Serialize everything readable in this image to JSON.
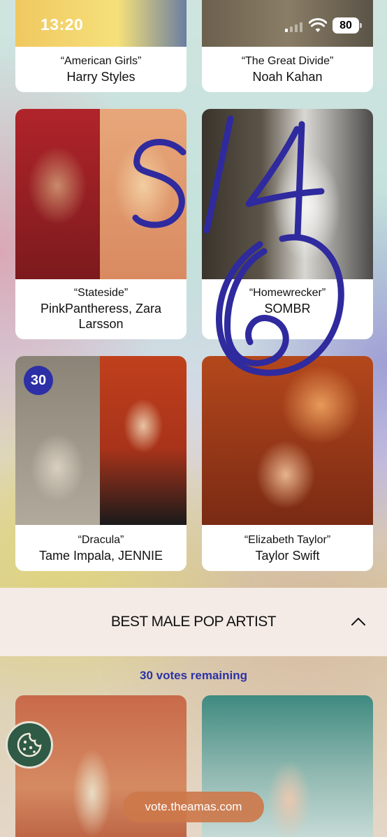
{
  "status_bar": {
    "time": "13:20",
    "battery": "80"
  },
  "nominees_top": [
    {
      "song": "“American Girls”",
      "artist": "Harry Styles"
    },
    {
      "song": "“The Great Divide”",
      "artist": "Noah Kahan"
    }
  ],
  "nominees": [
    {
      "song": "“Stateside”",
      "artist": "PinkPantheress, Zara Larsson"
    },
    {
      "song": "“Homewrecker”",
      "artist": "SOMBR"
    },
    {
      "song": "“Dracula”",
      "artist": "Tame Impala, JENNIE",
      "badge": "30"
    },
    {
      "song": "“Elizabeth Taylor”",
      "artist": "Taylor Swift"
    }
  ],
  "section": {
    "title": "BEST MALE POP ARTIST",
    "votes_remaining": "30 votes remaining"
  },
  "footer": {
    "url": "vote.theamas.com"
  },
  "colors": {
    "accent": "#2c2fa6",
    "annotation": "#2f2a9e",
    "cookie": "#2f5a45",
    "pill": "#cd784b"
  }
}
